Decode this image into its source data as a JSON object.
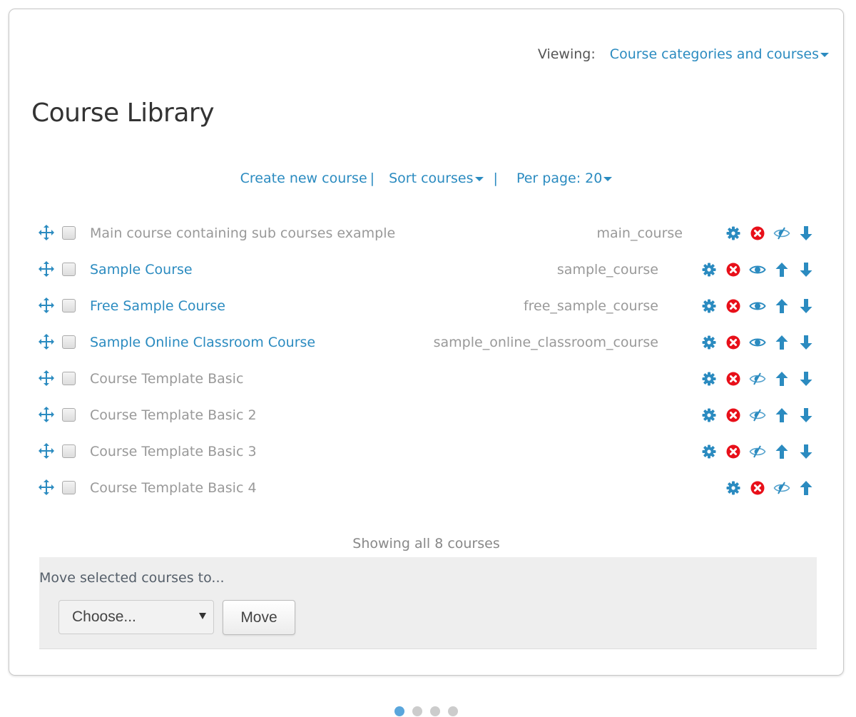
{
  "header": {
    "viewing_label": "Viewing:",
    "viewing_value": "Course categories and courses"
  },
  "page_title": "Course Library",
  "toolbar": {
    "create": "Create new course",
    "sort": "Sort courses",
    "per_page": "Per page: 20"
  },
  "courses": [
    {
      "name": "Main course containing sub courses example",
      "shortname": "main_course",
      "visible": false,
      "icons": [
        "gear",
        "delete",
        "hide",
        "down"
      ]
    },
    {
      "name": "Sample Course",
      "shortname": "sample_course",
      "visible": true,
      "icons": [
        "gear",
        "delete",
        "show",
        "up",
        "down"
      ]
    },
    {
      "name": "Free Sample Course",
      "shortname": "free_sample_course",
      "visible": true,
      "icons": [
        "gear",
        "delete",
        "show",
        "up",
        "down"
      ]
    },
    {
      "name": "Sample Online Classroom Course",
      "shortname": "sample_online_classroom_course",
      "visible": true,
      "icons": [
        "gear",
        "delete",
        "show",
        "up",
        "down"
      ]
    },
    {
      "name": "Course Template Basic",
      "shortname": "",
      "visible": false,
      "icons": [
        "gear",
        "delete",
        "hide",
        "up",
        "down"
      ]
    },
    {
      "name": "Course Template Basic 2",
      "shortname": "",
      "visible": false,
      "icons": [
        "gear",
        "delete",
        "hide",
        "up",
        "down"
      ]
    },
    {
      "name": "Course Template Basic 3",
      "shortname": "",
      "visible": false,
      "icons": [
        "gear",
        "delete",
        "hide",
        "up",
        "down"
      ]
    },
    {
      "name": "Course Template Basic 4",
      "shortname": "",
      "visible": false,
      "icons": [
        "gear",
        "delete",
        "hide",
        "up"
      ]
    }
  ],
  "showing": "Showing all 8 courses",
  "move": {
    "label": "Move selected courses to...",
    "select_value": "Choose...",
    "button": "Move"
  },
  "pager": {
    "pages": 4,
    "active": 1
  },
  "colors": {
    "link": "#2b8bc0",
    "delete": "#e8101a"
  }
}
